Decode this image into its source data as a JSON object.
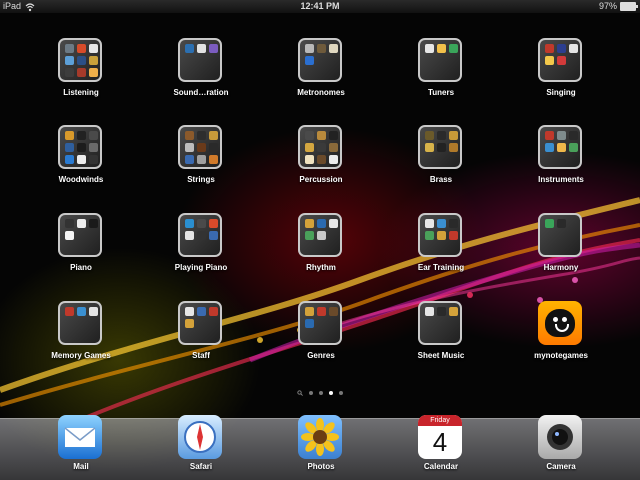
{
  "status_bar": {
    "device": "iPad",
    "time": "12:41 PM",
    "battery_text": "97%",
    "battery_level": 0.97,
    "wifi_icon": "wifi-icon"
  },
  "folders": [
    {
      "label": "Listening",
      "minis": [
        "#6c7a85",
        "#d64b2a",
        "#e8e8e8",
        "#5da0d8",
        "#2b4f86",
        "#caa13a",
        "#3d3d3d",
        "#a53a2a",
        "#f0b04a"
      ]
    },
    {
      "label": "Sound…ration",
      "minis": [
        "#2c6fb0",
        "#e2e2e2",
        "#7b5cc0"
      ]
    },
    {
      "label": "Metronomes",
      "minis": [
        "#b8b8b8",
        "#6e5a3b",
        "#e0d8c0",
        "#2b6fd0"
      ]
    },
    {
      "label": "Tuners",
      "minis": [
        "#e6e6e6",
        "#f2c04a",
        "#3aa55a"
      ]
    },
    {
      "label": "Singing",
      "minis": [
        "#c0392b",
        "#2c3e8f",
        "#e4e4e4",
        "#f3c84b",
        "#d23a3a"
      ]
    },
    {
      "label": "Woodwinds",
      "minis": [
        "#d99a2b",
        "#222222",
        "#4a4a4a",
        "#2f5f9e",
        "#1c1c1c",
        "#6b6b6b",
        "#2a7bd2",
        "#ededed",
        "#333333"
      ]
    },
    {
      "label": "Strings",
      "minis": [
        "#8c5a2b",
        "#2d2d2d",
        "#c79a3a",
        "#bdbdbd",
        "#6a3a1a",
        "#2a2a2a",
        "#3a6ab0",
        "#a0a0a0",
        "#d07a2a"
      ]
    },
    {
      "label": "Percussion",
      "minis": [
        "#4a4a4a",
        "#b98a3c",
        "#222222",
        "#d3a640",
        "#3a3a3a",
        "#8a6a3a",
        "#efe2c0",
        "#6a4a2a",
        "#ececec"
      ]
    },
    {
      "label": "Brass",
      "minis": [
        "#6b5a2a",
        "#2a2a2a",
        "#c89a38",
        "#d6b24a",
        "#222222",
        "#b07a2a"
      ]
    },
    {
      "label": "Instruments",
      "minis": [
        "#c0392b",
        "#7f8c8d",
        "#2a2a2a",
        "#3a8fd0",
        "#f0b84a",
        "#4aa05a"
      ]
    },
    {
      "label": "Piano",
      "minis": [
        "#333333",
        "#ededed",
        "#1a1a1a",
        "#f5f5f5"
      ]
    },
    {
      "label": "Playing Piano",
      "minis": [
        "#2a8fd0",
        "#4a4a4a",
        "#d84a2a",
        "#e4e4e4",
        "#333333",
        "#3a6ab0"
      ]
    },
    {
      "label": "Rhythm",
      "minis": [
        "#d4a23a",
        "#2a6ab0",
        "#e6e6e6",
        "#4aa05a",
        "#c8c8c8"
      ]
    },
    {
      "label": "Ear Training",
      "minis": [
        "#e6e6e6",
        "#3a8fd0",
        "#2a2a2a",
        "#4aa05a",
        "#d4a23a",
        "#c0392b"
      ]
    },
    {
      "label": "Harmony",
      "minis": [
        "#3aa55a",
        "#2a2a2a"
      ]
    },
    {
      "label": "Memory Games",
      "minis": [
        "#c0392b",
        "#3a8fd0",
        "#e4e4e4"
      ]
    },
    {
      "label": "Staff",
      "minis": [
        "#e6e6e6",
        "#3a6ab0",
        "#c0392b",
        "#d4a23a"
      ]
    },
    {
      "label": "Genres",
      "minis": [
        "#d4a23a",
        "#c0392b",
        "#6a4a2a",
        "#2a6ab0"
      ]
    },
    {
      "label": "Sheet Music",
      "minis": [
        "#e6e6e6",
        "#2a2a2a",
        "#d4a23a"
      ]
    }
  ],
  "app_standalone": {
    "label": "mynotegames",
    "icon": "smiley-face-icon"
  },
  "page_indicator": {
    "pages": 4,
    "active_page": 3,
    "search_icon": "search-icon"
  },
  "dock": [
    {
      "label": "Mail",
      "icon": "mail-envelope-icon"
    },
    {
      "label": "Safari",
      "icon": "safari-compass-icon"
    },
    {
      "label": "Photos",
      "icon": "sunflower-photos-icon"
    },
    {
      "label": "Calendar",
      "icon": "calendar-icon",
      "day": "Friday",
      "date": "4"
    },
    {
      "label": "Camera",
      "icon": "camera-lens-icon"
    }
  ]
}
